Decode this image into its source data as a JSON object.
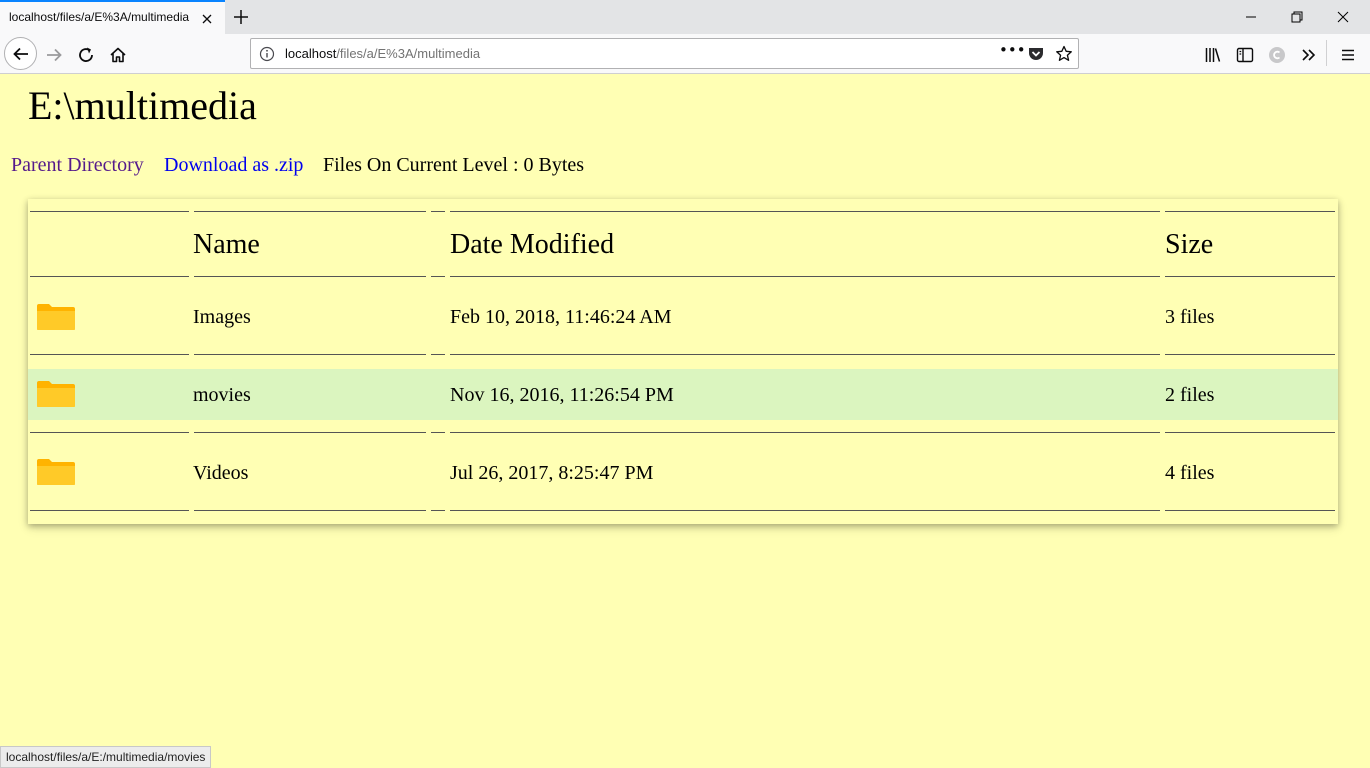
{
  "browser": {
    "tab_title": "localhost/files/a/E%3A/multimedia",
    "url_host": "localhost",
    "url_path": "/files/a/E%3A/multimedia",
    "url_more": "•••",
    "status_text": "localhost/files/a/E:/multimedia/movies"
  },
  "page": {
    "title": "E:\\multimedia",
    "parent_link": "Parent Directory",
    "download_link": "Download as .zip",
    "files_info": "Files On Current Level : 0 Bytes"
  },
  "table": {
    "headers": {
      "name": "Name",
      "date": "Date Modified",
      "size": "Size"
    },
    "rows": [
      {
        "icon": "folder-icon",
        "name": "Images",
        "date": "Feb 10, 2018, 11:46:24 AM",
        "size": "3 files",
        "highlighted": false
      },
      {
        "icon": "folder-icon",
        "name": "movies",
        "date": "Nov 16, 2016, 11:26:54 PM",
        "size": "2 files",
        "highlighted": true
      },
      {
        "icon": "folder-icon",
        "name": "Videos",
        "date": "Jul 26, 2017, 8:25:47 PM",
        "size": "4 files",
        "highlighted": false
      }
    ]
  },
  "colors": {
    "page_background": "#ffffb4",
    "row_highlight": "#dbf5bf",
    "visited_link": "#551a8b",
    "link": "#0000ee",
    "folder": "#ffc107"
  }
}
